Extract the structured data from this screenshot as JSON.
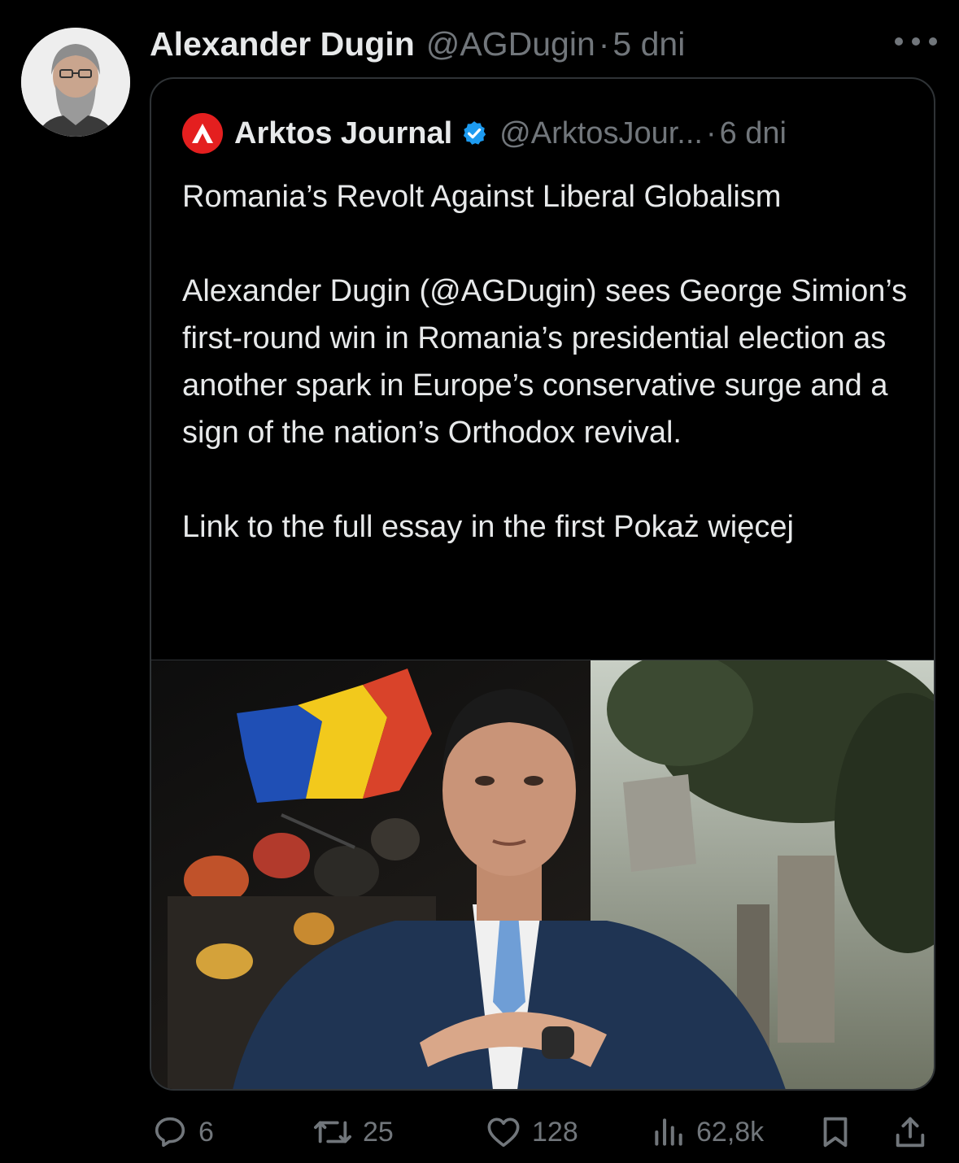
{
  "tweet": {
    "author_name": "Alexander Dugin",
    "author_handle": "@AGDugin",
    "separator": "·",
    "time": "5 dni"
  },
  "quoted": {
    "author_name": "Arktos Journal",
    "author_handle": "@ArktosJour...",
    "separator": "·",
    "time": "6 dni",
    "verified": true,
    "title": "Romania’s Revolt Against Liberal Globalism",
    "paragraph": "Alexander Dugin (@AGDugin) sees George Simion’s first-round win in Romania’s presidential election as another spark in Europe’s conservative surge and a sign of the nation’s Orthodox revival.",
    "link_text": "Link to the full essay in the first",
    "show_more": "Pokaż więcej"
  },
  "actions": {
    "replies": "6",
    "reposts": "25",
    "likes": "128",
    "views": "62,8k"
  },
  "colors": {
    "background": "#000000",
    "text_primary": "#e7e9ea",
    "text_secondary": "#71767b",
    "border": "#2f3336",
    "verified_blue": "#1d9bf0",
    "arktos_red": "#e41f1f"
  },
  "icons": [
    "more-icon",
    "verified-icon",
    "reply-icon",
    "repost-icon",
    "like-icon",
    "views-icon",
    "bookmark-icon",
    "share-icon"
  ]
}
